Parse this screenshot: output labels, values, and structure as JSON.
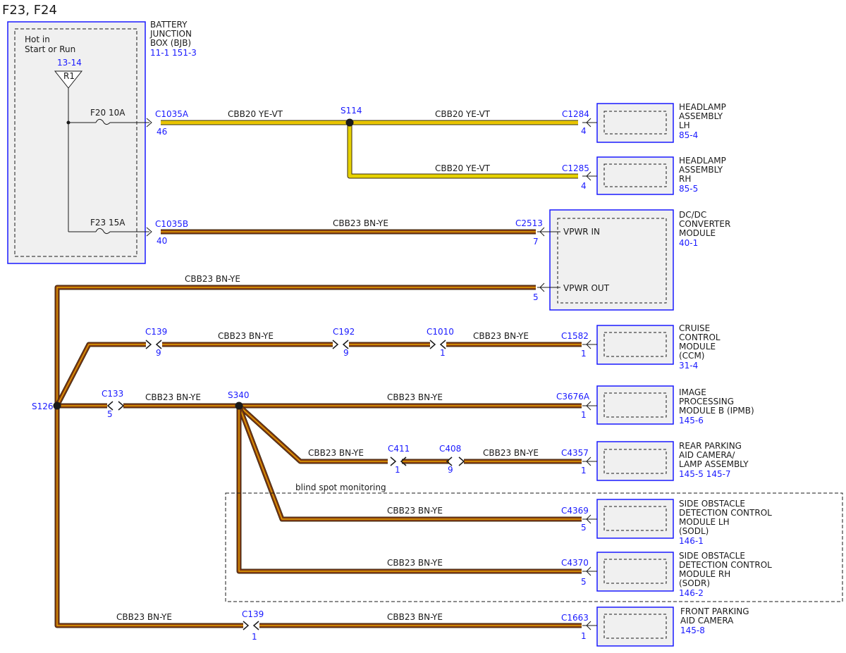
{
  "title": "F23, F24",
  "bjb": {
    "name_lines": [
      "BATTERY",
      "JUNCTION",
      "BOX (BJB)"
    ],
    "refs": "11-1  151-3",
    "hot_lines": [
      "Hot in",
      "Start or Run"
    ],
    "relay_ref": "13-14",
    "relay": "R1",
    "fuse_f20": "F20  10A",
    "fuse_f23": "F23  15A"
  },
  "connectors": {
    "c1035a": "C1035A",
    "c1035a_pin": "46",
    "c1035b": "C1035B",
    "c1035b_pin": "40",
    "c1284": "C1284",
    "c1284_pin": "4",
    "c1285": "C1285",
    "c1285_pin": "4",
    "c2513": "C2513",
    "c2513_pin_in": "7",
    "c2513_pin_out": "5",
    "c139_top": "C139",
    "c139_top_pin": "9",
    "c192": "C192",
    "c192_pin": "9",
    "c1010": "C1010",
    "c1010_pin": "1",
    "c1582": "C1582",
    "c1582_pin": "1",
    "c133": "C133",
    "c133_pin": "5",
    "c3676a": "C3676A",
    "c3676a_pin": "1",
    "c411": "C411",
    "c411_pin": "1",
    "c408": "C408",
    "c408_pin": "9",
    "c4357": "C4357",
    "c4357_pin": "1",
    "c4369": "C4369",
    "c4369_pin": "5",
    "c4370": "C4370",
    "c4370_pin": "5",
    "c139_bottom": "C139",
    "c139_bottom_pin": "1",
    "c1663": "C1663",
    "c1663_pin": "1"
  },
  "splices": {
    "s114": "S114",
    "s126": "S126",
    "s340": "S340"
  },
  "wires": {
    "cbb20": "CBB20  YE-VT",
    "cbb23": "CBB23  BN-YE"
  },
  "modules": {
    "headlamp_lh": {
      "lines": [
        "HEADLAMP",
        "ASSEMBLY",
        "LH"
      ],
      "ref": "85-4"
    },
    "headlamp_rh": {
      "lines": [
        "HEADLAMP",
        "ASSEMBLY",
        "RH"
      ],
      "ref": "85-5"
    },
    "dcdc": {
      "lines": [
        "DC/DC",
        "CONVERTER",
        "MODULE"
      ],
      "ref": "40-1",
      "in_label": "VPWR IN",
      "out_label": "VPWR OUT"
    },
    "ccm": {
      "lines": [
        "CRUISE",
        "CONTROL",
        "MODULE",
        "(CCM)"
      ],
      "ref": "31-4"
    },
    "ipmb": {
      "lines": [
        "IMAGE",
        "PROCESSING",
        "MODULE B (IPMB)"
      ],
      "ref": "145-6"
    },
    "rear_camera": {
      "lines": [
        "REAR PARKING",
        "AID CAMERA/",
        "LAMP ASSEMBLY"
      ],
      "ref": "145-5  145-7"
    },
    "sodl": {
      "lines": [
        "SIDE OBSTACLE",
        "DETECTION CONTROL",
        "MODULE LH",
        "(SODL)"
      ],
      "ref": "146-1"
    },
    "sodr": {
      "lines": [
        "SIDE OBSTACLE",
        "DETECTION CONTROL",
        "MODULE RH",
        "(SODR)"
      ],
      "ref": "146-2"
    },
    "front_camera": {
      "lines": [
        "FRONT PARKING",
        "AID CAMERA"
      ],
      "ref": "145-8"
    }
  },
  "blind_spot_label": "blind spot monitoring",
  "colors": {
    "module_border": "#1a1aff",
    "module_fill": "#f0f0f0",
    "label_blue": "#1a1aff",
    "wire_ye_vt": "#e6d200",
    "wire_bn_ye": "#8a3a10"
  }
}
